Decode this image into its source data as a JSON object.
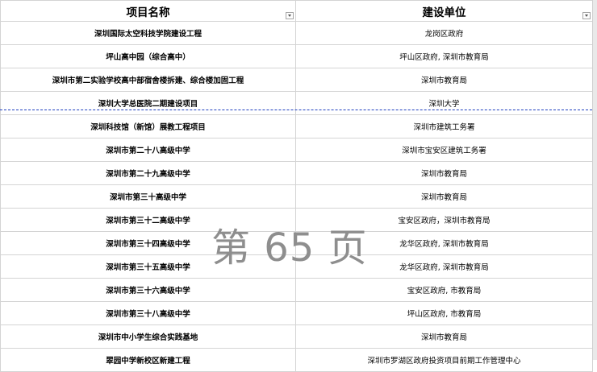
{
  "header": {
    "col1": "项目名称",
    "col2": "建设单位"
  },
  "rows": [
    {
      "project": "深圳国际太空科技学院建设工程",
      "unit": "龙岗区政府"
    },
    {
      "project": "坪山高中园（综合高中）",
      "unit": "坪山区政府, 深圳市教育局"
    },
    {
      "project": "深圳市第二实验学校高中部宿舍楼拆建、综合楼加固工程",
      "unit": "深圳市教育局"
    },
    {
      "project": "深圳大学总医院二期建设项目",
      "unit": "深圳大学"
    },
    {
      "project": "深圳科技馆（新馆）展教工程项目",
      "unit": "深圳市建筑工务署"
    },
    {
      "project": "深圳市第二十八高级中学",
      "unit": "深圳市宝安区建筑工务署"
    },
    {
      "project": "深圳市第二十九高级中学",
      "unit": "深圳市教育局"
    },
    {
      "project": "深圳市第三十高级中学",
      "unit": "深圳市教育局"
    },
    {
      "project": "深圳市第三十二高级中学",
      "unit": "宝安区政府，深圳市教育局"
    },
    {
      "project": "深圳市第三十四高级中学",
      "unit": "龙华区政府, 深圳市教育局"
    },
    {
      "project": "深圳市第三十五高级中学",
      "unit": "龙华区政府, 深圳市教育局"
    },
    {
      "project": "深圳市第三十六高级中学",
      "unit": "宝安区政府, 市教育局"
    },
    {
      "project": "深圳市第三十八高级中学",
      "unit": "坪山区政府, 市教育局"
    },
    {
      "project": "深圳市中小学生综合实践基地",
      "unit": "深圳市教育局"
    },
    {
      "project": "翠园中学新校区新建工程",
      "unit": "深圳市罗湖区政府投资项目前期工作管理中心"
    }
  ],
  "watermark": "第 65 页"
}
